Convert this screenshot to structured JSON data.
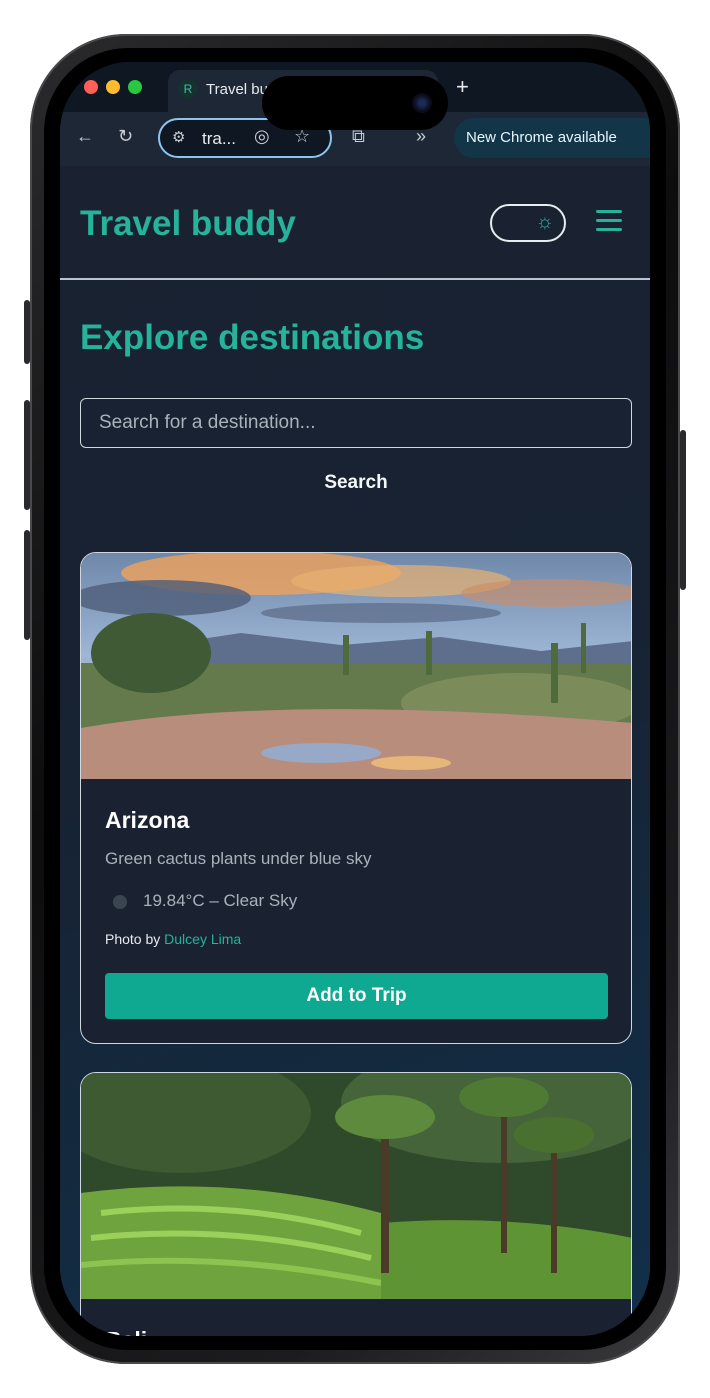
{
  "browser": {
    "tab_title": "Travel bu",
    "tab_favicon": "R",
    "new_tab": "+",
    "url": "tra...",
    "update_label": "New Chrome available",
    "icons": [
      "back-arrow-icon",
      "reload-icon",
      "site-settings-icon",
      "eye-off-icon",
      "star-icon",
      "extensions-icon",
      "chevron-double-right-icon",
      "more-vert-icon"
    ]
  },
  "header": {
    "brand": "Travel buddy",
    "theme_icon": "sun-icon",
    "menu_icon": "hamburger-menu-icon"
  },
  "main": {
    "heading": "Explore destinations",
    "search_placeholder": "Search for a destination...",
    "search_button": "Search"
  },
  "cards": [
    {
      "title": "Arizona",
      "description": "Green cactus plants under blue sky",
      "weather": "19.84°C – Clear Sky",
      "credit_prefix": "Photo by ",
      "credit_name": "Dulcey Lima",
      "button": "Add to Trip"
    },
    {
      "title": "Bali"
    }
  ],
  "colors": {
    "accent": "#25b39b",
    "button": "#0fa890",
    "background": "#1a2231"
  }
}
